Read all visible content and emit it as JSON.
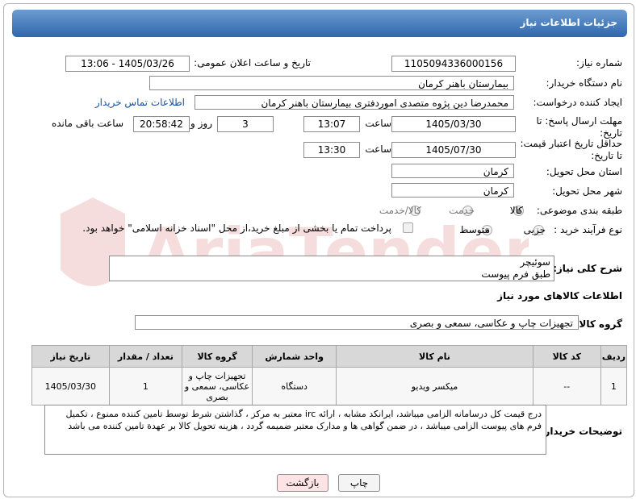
{
  "header": {
    "title": "جزئیات اطلاعات نیاز"
  },
  "need_number": {
    "label": "شماره نیاز:",
    "value": "1105094336000156"
  },
  "announce": {
    "label": "تاریخ و ساعت اعلان عمومی:",
    "value": "1405/03/26 - 13:06"
  },
  "buyer": {
    "label": "نام دستگاه خریدار:",
    "value": "بیمارستان باهنر کرمان"
  },
  "creator": {
    "label": "ایجاد کننده درخواست:",
    "value": "محمدرضا  دین پژوه متصدی اموردفتری بیمارستان باهنر کرمان",
    "contact_link": "اطلاعات تماس خریدار"
  },
  "deadline": {
    "label": "مهلت ارسال پاسخ: تا تاریخ:",
    "date": "1405/03/30",
    "time_label": "ساعت",
    "time": "13:07",
    "days": "3",
    "days_label": "روز و",
    "remaining": "20:58:42",
    "remaining_label": "ساعت باقی مانده"
  },
  "price_validity": {
    "label": "حداقل تاریخ اعتبار قیمت: تا تاریخ:",
    "date": "1405/07/30",
    "time_label": "ساعت",
    "time": "13:30"
  },
  "province": {
    "label": "استان محل تحویل:",
    "value": "کرمان"
  },
  "city": {
    "label": "شهر محل تحویل:",
    "value": "کرمان"
  },
  "category": {
    "label": "طبقه بندی موضوعی:",
    "options": [
      "کالا",
      "خدمت",
      "کالا/خدمت"
    ]
  },
  "process": {
    "label": "نوع فرآیند خرید :",
    "options": [
      "جزیی",
      "متوسط"
    ],
    "payment_note": "پرداخت تمام یا بخشی از مبلغ خرید،از محل \"اسناد خزانه اسلامی\" خواهد بود."
  },
  "description": {
    "label": "شرح کلی نیاز:",
    "line1": "سوئیچر",
    "line2": "طبق فرم پیوست"
  },
  "goods_info": {
    "title": "اطلاعات کالاهای مورد نیاز"
  },
  "goods_group": {
    "label": "گروه کالا:",
    "value": "تجهیزات چاپ و عکاسی، سمعی و بصری"
  },
  "table": {
    "headers": [
      "ردیف",
      "کد کالا",
      "نام کالا",
      "واحد شمارش",
      "گروه کالا",
      "تعداد / مقدار",
      "تاریخ نیاز"
    ],
    "rows": [
      [
        "1",
        "--",
        "میکسر ویدیو",
        "دستگاه",
        "تجهیزات چاپ و عکاسی، سمعی و بصری",
        "1",
        "1405/03/30"
      ]
    ]
  },
  "buyer_notes": {
    "label": "توضیحات خریدار:",
    "text": "درج قیمت کل درسامانه الزامی میباشد، ایرانکد مشابه ، ارائه irc معتبر به مرکز ، گذاشتن شرط توسط تامین کننده ممنوع ، تکمیل فرم های پیوست الزامی میباشد ، در ضمن گواهی ها و مدارک معتبر ضمیمه گردد ، هزینه تحویل کالا بر عهدة تامین کننده می باشد"
  },
  "buttons": {
    "print": "چاپ",
    "back": "بازگشت"
  },
  "colors": {
    "header_top": "#6d9cd0",
    "header_bottom": "#2f67ad",
    "link": "#1a4fa0",
    "back_button": "#fde3e3"
  }
}
